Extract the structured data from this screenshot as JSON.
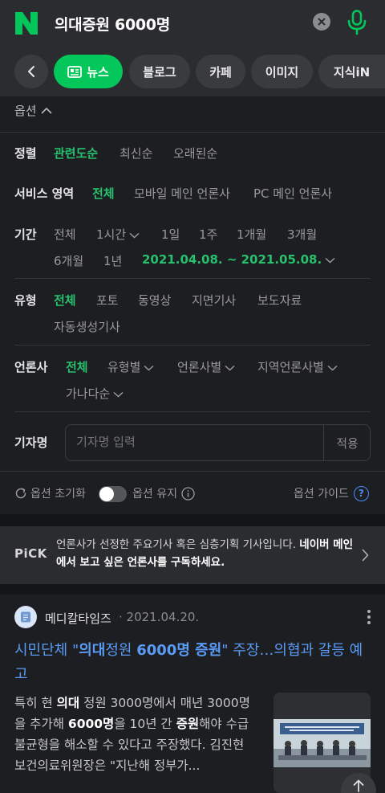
{
  "header": {
    "query": "의대증원 6000명",
    "logo": "naver-n-logo",
    "brand_color": "#03c75a"
  },
  "tabs": {
    "news": "뉴스",
    "blog": "블로그",
    "cafe": "카페",
    "image": "이미지",
    "kin": "지식iN"
  },
  "options": {
    "toggle_label": "옵션",
    "sort": {
      "label": "정렬",
      "items": [
        "관련도순",
        "최신순",
        "오래된순"
      ]
    },
    "service": {
      "label": "서비스 영역",
      "items": [
        "전체",
        "모바일 메인 언론사",
        "PC 메인 언론사"
      ]
    },
    "period": {
      "label": "기간",
      "items": [
        "전체",
        "1시간",
        "1일",
        "1주",
        "1개월",
        "3개월",
        "6개월",
        "1년"
      ],
      "selected_range": "2021.04.08. ~ 2021.05.08."
    },
    "type": {
      "label": "유형",
      "items": [
        "전체",
        "포토",
        "동영상",
        "지면기사",
        "보도자료",
        "자동생성기사"
      ]
    },
    "press": {
      "label": "언론사",
      "items": [
        "전체",
        "유형별",
        "언론사별",
        "지역언론사별",
        "가나다순"
      ]
    },
    "reporter": {
      "label": "기자명",
      "placeholder": "기자명 입력",
      "apply": "적용"
    },
    "reset": "옵션 초기화",
    "keep": "옵션 유지",
    "guide": "옵션 가이드"
  },
  "pick": {
    "logo": "PiCK",
    "text_plain": "언론사가 선정한 주요기사 혹은 심층기획 기사입니다. ",
    "text_bold": "네이버 메인에서 보고 싶은 언론사를 구독하세요."
  },
  "article": {
    "press": "메디칼타임즈",
    "date": "· 2021.04.20.",
    "title_parts": [
      "시민단체 \"",
      "의대",
      "정원 ",
      "6000명 증원",
      "\" 주장…의협과 갈등 예고"
    ],
    "snippet_parts": [
      "특히 현 ",
      "의대",
      " 정원 3000명에서 매년 3000명을 추가해 ",
      "6000명",
      "을 10년 간 ",
      "증원",
      "해야 수급 불균형을 해소할 수 있다고 주장했다. 김진현 보건의료위원장은 \"지난해 정부가..."
    ]
  },
  "colors": {
    "accent_green": "#27c16d",
    "link_blue": "#5a9bf7",
    "background": "#1d1e21"
  }
}
